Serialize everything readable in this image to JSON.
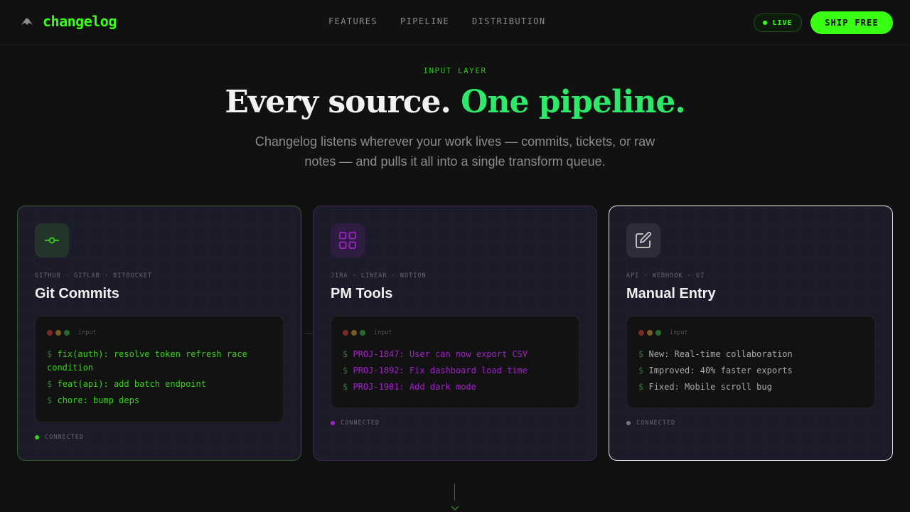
{
  "header": {
    "logo_text": "changelog",
    "logo_icon": "bird-icon",
    "nav": [
      {
        "label": "FEATURES"
      },
      {
        "label": "PIPELINE"
      },
      {
        "label": "DISTRIBUTION"
      }
    ],
    "live_label": "LIVE",
    "cta_label": "SHIP FREE"
  },
  "hero": {
    "eyebrow": "INPUT LAYER",
    "headline_main": "Every source.",
    "headline_accent": "One pipeline.",
    "subtitle": "Changelog listens wherever your work lives — commits, tickets, or raw notes — and pulls it all into a single transform queue."
  },
  "cards": [
    {
      "icon": "git-commit-icon",
      "sources": "GITHUB · GITLAB · BITBUCKET",
      "title": "Git Commits",
      "terminal_label": "input",
      "lines": [
        {
          "prompt": "$",
          "text": "fix(auth): resolve token refresh race condition"
        },
        {
          "prompt": "$",
          "text": "feat(api): add batch endpoint"
        },
        {
          "prompt": "$",
          "text": "chore: bump deps"
        }
      ],
      "status": "CONNECTED"
    },
    {
      "icon": "grid-icon",
      "sources": "JIRA · LINEAR · NOTION",
      "title": "PM Tools",
      "terminal_label": "input",
      "lines": [
        {
          "prompt": "$",
          "text": "PROJ-1847: User can now export CSV"
        },
        {
          "prompt": "$",
          "text": "PROJ-1892: Fix dashboard load time"
        },
        {
          "prompt": "$",
          "text": "PROJ-1901: Add dark mode"
        }
      ],
      "status": "CONNECTED"
    },
    {
      "icon": "edit-icon",
      "sources": "API · WEBHOOK · UI",
      "title": "Manual Entry",
      "terminal_label": "input",
      "lines": [
        {
          "prompt": "$",
          "text": "New: Real-time collaboration"
        },
        {
          "prompt": "$",
          "text": "Improved: 40% faster exports"
        },
        {
          "prompt": "$",
          "text": "Fixed: Mobile scroll bug"
        }
      ],
      "status": "CONNECTED"
    }
  ],
  "colors": {
    "brand_green": "#39ff14",
    "headline_accent": "#2ee86a",
    "pm_purple": "#a020c8",
    "background": "#111111"
  }
}
